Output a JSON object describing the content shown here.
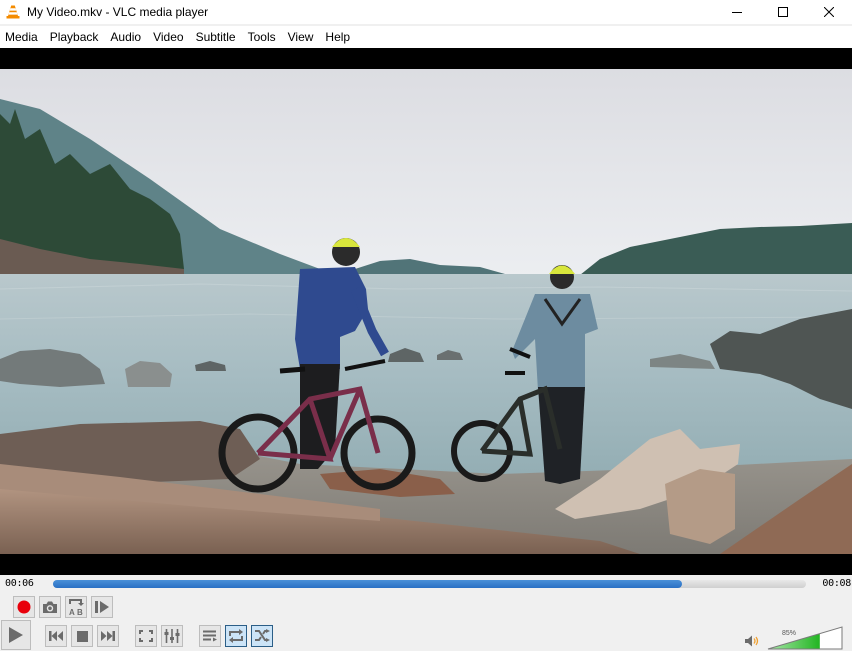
{
  "window": {
    "title": "My Video.mkv - VLC media player",
    "app_icon": "vlc-cone-icon",
    "controls": [
      "minimize",
      "maximize",
      "close"
    ]
  },
  "menu": {
    "items": [
      {
        "label": "Media"
      },
      {
        "label": "Playback"
      },
      {
        "label": "Audio"
      },
      {
        "label": "Video"
      },
      {
        "label": "Subtitle"
      },
      {
        "label": "Tools"
      },
      {
        "label": "View"
      },
      {
        "label": "Help"
      }
    ]
  },
  "video": {
    "description": "Two mountain bikers with yellow helmets standing with bikes on a driftwood beach overlooking a misty lake and forested mountains"
  },
  "playback": {
    "elapsed": "00:06",
    "total": "00:08",
    "progress_fraction": 0.835
  },
  "controls": {
    "row1": [
      {
        "name": "record",
        "icon": "record-icon",
        "active": false
      },
      {
        "name": "snapshot",
        "icon": "camera-icon",
        "active": false
      },
      {
        "name": "loop-ab",
        "icon": "ab-loop-icon",
        "active": false
      },
      {
        "name": "frame-by-frame",
        "icon": "frame-step-icon",
        "active": false
      }
    ],
    "row2": [
      {
        "name": "play",
        "icon": "play-icon",
        "active": false
      },
      {
        "name": "previous",
        "icon": "previous-icon",
        "active": false
      },
      {
        "name": "stop",
        "icon": "stop-icon",
        "active": false
      },
      {
        "name": "next",
        "icon": "next-icon",
        "active": false
      },
      {
        "name": "fullscreen",
        "icon": "fullscreen-icon",
        "active": false
      },
      {
        "name": "extended-settings",
        "icon": "equalizer-icon",
        "active": false
      },
      {
        "name": "playlist",
        "icon": "playlist-icon",
        "active": false
      },
      {
        "name": "loop",
        "icon": "loop-icon",
        "active": true
      },
      {
        "name": "random",
        "icon": "shuffle-icon",
        "active": true
      }
    ]
  },
  "volume": {
    "label": "85%",
    "level_fraction": 0.7,
    "icon": "speaker-icon"
  },
  "colors": {
    "accent_progress": "#2a70c4",
    "record_red": "#e8000b",
    "volume_green": "#2fbf2f",
    "active_button_bg": "#cce4f7",
    "active_button_border": "#2b5e87",
    "vlc_orange": "#f48b00"
  }
}
